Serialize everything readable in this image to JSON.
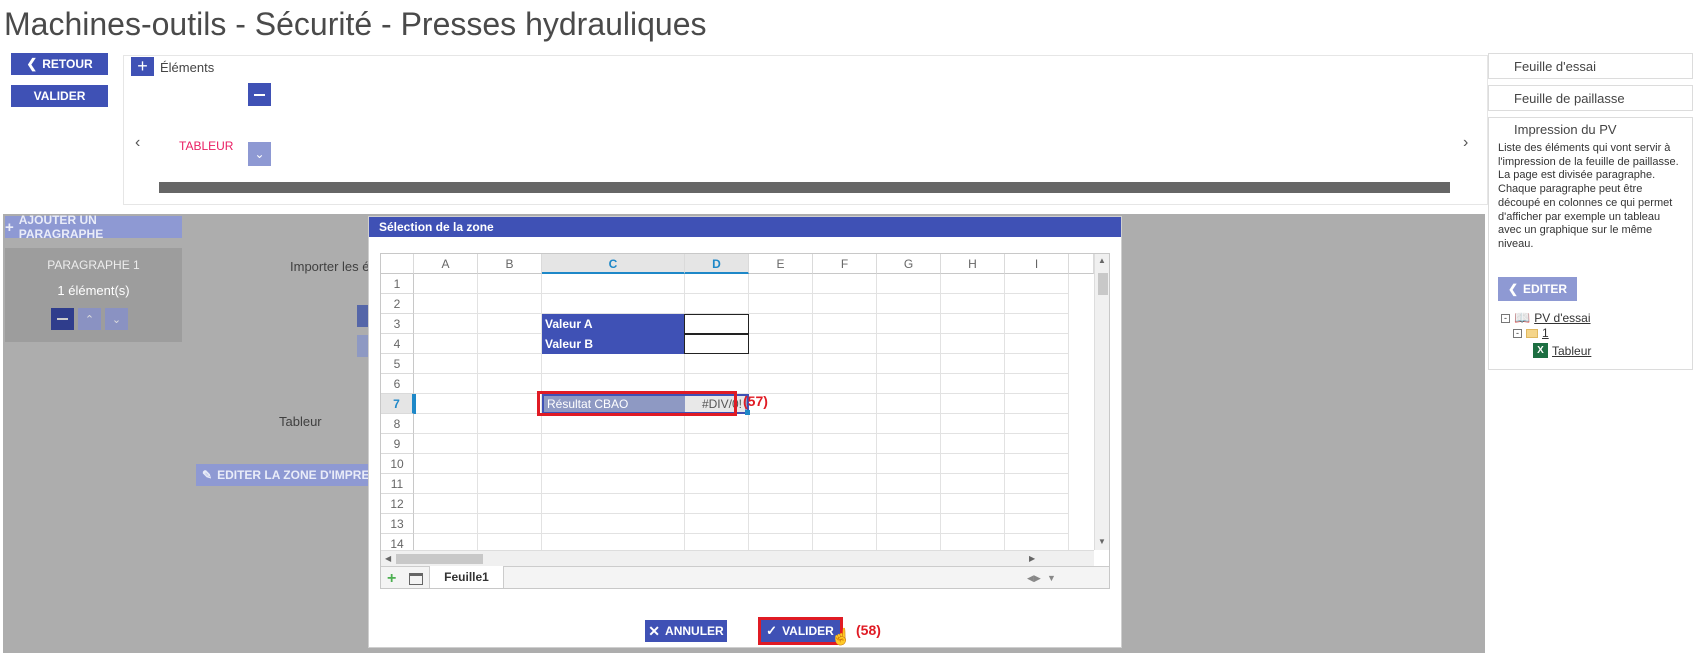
{
  "page": {
    "title": "Machines-outils - Sécurité - Presses hydrauliques"
  },
  "left_actions": {
    "back_label": "RETOUR",
    "validate_label": "VALIDER"
  },
  "elements_panel": {
    "title": "Éléments",
    "tableur_label": "TABLEUR"
  },
  "right_panel": {
    "tabs": [
      "Feuille d'essai",
      "Feuille de paillasse",
      "Impression du PV"
    ],
    "description": "Liste des éléments qui vont servir à l'impression de la feuille de paillasse.\nLa page est divisée paragraphe. Chaque paragraphe peut être découpé en colonnes ce qui permet d'afficher par exemple un tableau avec un graphique sur le même niveau.",
    "edit_label": "EDITER",
    "tree": {
      "root": "PV d'essai",
      "child": "1",
      "leaf": "Tableur"
    }
  },
  "background": {
    "add_paragraph_label": "AJOUTER UN PARAGRAPHE",
    "paragraph_title": "PARAGRAPHE 1",
    "paragraph_count": "1 élément(s)",
    "import_label": "Importer les é",
    "tableur_label": "Tableur",
    "edit_zone_label": "EDITER LA ZONE D'IMPRESS"
  },
  "dialog": {
    "title": "Sélection de la zone",
    "columns": [
      "A",
      "B",
      "C",
      "D",
      "E",
      "F",
      "G",
      "H",
      "I"
    ],
    "rows": [
      "1",
      "2",
      "3",
      "4",
      "5",
      "6",
      "7",
      "8",
      "9",
      "10",
      "11",
      "12",
      "13",
      "14"
    ],
    "cells": {
      "valeur_a": "Valeur A",
      "valeur_b": "Valeur B",
      "resultat": "Résultat CBAO",
      "resultat_value": "#DIV/0!"
    },
    "sheet_tab": "Feuille1",
    "cancel_label": "ANNULER",
    "validate_label": "VALIDER"
  },
  "annotations": {
    "cell_marker": "(57)",
    "button_marker": "(58)"
  },
  "colors": {
    "primary": "#3f51b5",
    "annotation_red": "#e01b24",
    "overlay": "#adadad",
    "tableur_pink": "#e91e63"
  }
}
